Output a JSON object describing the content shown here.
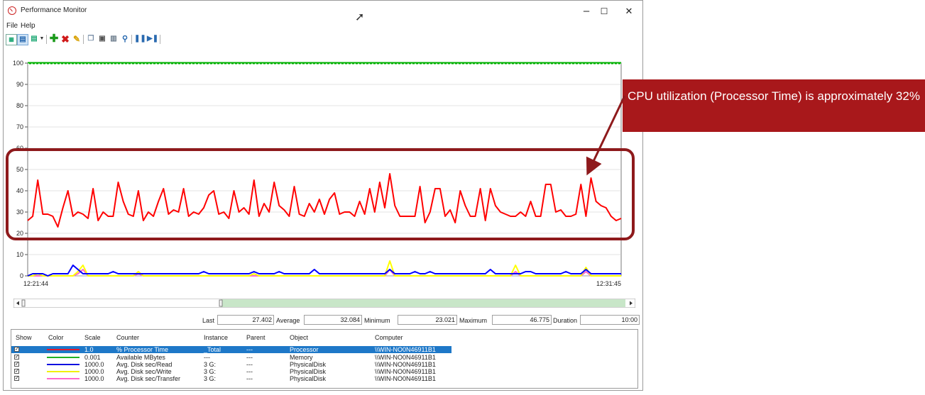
{
  "window": {
    "title": "Performance Monitor",
    "controls": {
      "minimize": "–",
      "maximize": "☐",
      "close": "✕"
    }
  },
  "menu": {
    "file": "File",
    "help": "Help"
  },
  "toolbar_icons": [
    "view-current-activity-icon",
    "view-log-data-icon",
    "change-graph-type-icon",
    "dropdown-arrow-icon",
    "add-counter-icon",
    "delete-counter-icon",
    "highlight-icon",
    "copy-properties-icon",
    "paste-counter-list-icon",
    "properties-icon",
    "zoom-icon",
    "freeze-display-icon",
    "update-data-icon"
  ],
  "chart": {
    "y_ticks": [
      "100",
      "90",
      "80",
      "70",
      "60",
      "50",
      "40",
      "30",
      "20",
      "10",
      "0"
    ],
    "ylim": [
      0,
      100
    ],
    "x_start_label": "12:21:44",
    "x_end_label": "12:31:45"
  },
  "chart_data": {
    "type": "line",
    "ylim": [
      0,
      100
    ],
    "x_labels": [
      "12:21:44",
      "12:31:45"
    ],
    "series": [
      {
        "name": "% Processor Time",
        "color": "#ff0000",
        "values": [
          26,
          28,
          45,
          29,
          29,
          28,
          23,
          32,
          40,
          28,
          30,
          29,
          27,
          41,
          26,
          30,
          28,
          28,
          44,
          35,
          29,
          28,
          40,
          26,
          30,
          28,
          35,
          41,
          29,
          31,
          30,
          41,
          28,
          30,
          29,
          32,
          38,
          40,
          29,
          30,
          27,
          40,
          30,
          32,
          29,
          45,
          28,
          34,
          30,
          44,
          33,
          31,
          28,
          42,
          29,
          28,
          34,
          30,
          36,
          29,
          36,
          39,
          29,
          30,
          30,
          28,
          35,
          29,
          41,
          30,
          44,
          32,
          48,
          33,
          28,
          28,
          28,
          28,
          42,
          25,
          30,
          41,
          41,
          28,
          31,
          25,
          40,
          33,
          28,
          28,
          41,
          26,
          41,
          33,
          30,
          29,
          28,
          28,
          30,
          28,
          35,
          28,
          28,
          43,
          43,
          30,
          31,
          28,
          28,
          29,
          43,
          28,
          46,
          35,
          33,
          32,
          28,
          26,
          27
        ]
      },
      {
        "name": "Available MBytes",
        "color": "#00b000",
        "values": [
          100,
          100,
          100,
          100,
          100,
          100,
          100,
          100,
          100,
          100,
          100,
          100,
          100,
          100,
          100,
          100,
          100,
          100,
          100,
          100,
          100,
          100,
          100,
          100,
          100,
          100,
          100,
          100,
          100,
          100,
          100,
          100,
          100,
          100,
          100,
          100,
          100,
          100,
          100,
          100,
          100,
          100,
          100,
          100,
          100,
          100,
          100,
          100,
          100,
          100,
          100,
          100,
          100,
          100,
          100,
          100,
          100,
          100,
          100,
          100,
          100,
          100,
          100,
          100,
          100,
          100,
          100,
          100,
          100,
          100,
          100,
          100,
          100,
          100,
          100,
          100,
          100,
          100,
          100,
          100,
          100,
          100,
          100,
          100,
          100,
          100,
          100,
          100,
          100,
          100,
          100,
          100,
          100,
          100,
          100,
          100,
          100,
          100,
          100,
          100,
          100,
          100,
          100,
          100,
          100,
          100,
          100,
          100,
          100,
          100,
          100,
          100,
          100,
          100,
          100,
          100,
          100,
          100,
          100
        ]
      },
      {
        "name": "Avg. Disk sec/Read",
        "color": "#0000ff",
        "values": [
          0,
          1,
          1,
          1,
          0,
          1,
          1,
          1,
          1,
          5,
          3,
          1,
          1,
          1,
          1,
          1,
          1,
          2,
          1,
          1,
          1,
          1,
          1,
          1,
          1,
          1,
          1,
          1,
          1,
          1,
          1,
          1,
          1,
          1,
          1,
          2,
          1,
          1,
          1,
          1,
          1,
          1,
          1,
          1,
          1,
          2,
          1,
          1,
          1,
          1,
          2,
          1,
          1,
          1,
          1,
          1,
          1,
          3,
          1,
          1,
          1,
          1,
          1,
          1,
          1,
          1,
          1,
          1,
          1,
          1,
          1,
          1,
          3,
          1,
          1,
          1,
          1,
          2,
          1,
          1,
          2,
          1,
          1,
          1,
          1,
          1,
          1,
          1,
          1,
          1,
          1,
          1,
          3,
          1,
          1,
          1,
          1,
          1,
          1,
          2,
          2,
          1,
          1,
          1,
          1,
          1,
          1,
          2,
          1,
          1,
          1,
          3,
          1,
          1,
          1,
          1,
          1,
          1,
          1
        ]
      },
      {
        "name": "Avg. Disk sec/Write",
        "color": "#ffff00",
        "values": [
          0,
          0,
          1,
          0,
          0,
          0,
          0,
          0,
          0,
          0,
          2,
          5,
          0,
          0,
          0,
          0,
          0,
          0,
          0,
          0,
          0,
          0,
          2,
          0,
          0,
          0,
          0,
          0,
          0,
          0,
          0,
          0,
          0,
          0,
          0,
          0,
          0,
          0,
          0,
          0,
          0,
          0,
          0,
          0,
          0,
          1,
          0,
          0,
          0,
          0,
          0,
          0,
          0,
          0,
          0,
          0,
          0,
          0,
          0,
          0,
          0,
          0,
          0,
          0,
          0,
          0,
          0,
          0,
          0,
          0,
          0,
          0,
          7,
          0,
          0,
          0,
          0,
          0,
          0,
          0,
          0,
          0,
          0,
          0,
          0,
          0,
          0,
          0,
          0,
          0,
          0,
          0,
          0,
          0,
          0,
          0,
          0,
          5,
          0,
          0,
          0,
          0,
          0,
          0,
          0,
          0,
          0,
          0,
          0,
          0,
          0,
          4,
          0,
          0,
          0,
          0,
          0,
          0,
          0
        ]
      },
      {
        "name": "Avg. Disk sec/Transfer",
        "color": "#ff66cc",
        "values": [
          0,
          0,
          0,
          0,
          0,
          0,
          0,
          0,
          0,
          0,
          1,
          3,
          0,
          0,
          0,
          0,
          0,
          0,
          0,
          0,
          0,
          0,
          1,
          0,
          0,
          0,
          0,
          0,
          0,
          0,
          0,
          0,
          0,
          0,
          0,
          0,
          0,
          0,
          0,
          0,
          0,
          0,
          0,
          0,
          0,
          0,
          0,
          0,
          0,
          0,
          0,
          0,
          0,
          0,
          0,
          0,
          0,
          0,
          0,
          0,
          0,
          0,
          0,
          0,
          0,
          0,
          0,
          0,
          0,
          0,
          0,
          0,
          3,
          0,
          0,
          0,
          0,
          0,
          0,
          0,
          0,
          0,
          0,
          0,
          0,
          0,
          0,
          0,
          0,
          0,
          0,
          0,
          0,
          0,
          0,
          0,
          0,
          2,
          0,
          0,
          0,
          0,
          0,
          0,
          0,
          0,
          0,
          0,
          0,
          0,
          0,
          2,
          0,
          0,
          0,
          0,
          0,
          0,
          0
        ]
      }
    ]
  },
  "stats": {
    "last_label": "Last",
    "last": "27.402",
    "average_label": "Average",
    "average": "32.084",
    "minimum_label": "Minimum",
    "minimum": "23.021",
    "maximum_label": "Maximum",
    "maximum": "46.775",
    "duration_label": "Duration",
    "duration": "10:00"
  },
  "legend": {
    "headers": {
      "show": "Show",
      "color": "Color",
      "scale": "Scale",
      "counter": "Counter",
      "instance": "Instance",
      "parent": "Parent",
      "object": "Object",
      "computer": "Computer"
    },
    "rows": [
      {
        "color": "#e8192c",
        "scale": "1.0",
        "counter": "% Processor Time",
        "instance": "_Total",
        "parent": "---",
        "object": "Processor",
        "computer": "\\\\WIN-NO0N46911B1"
      },
      {
        "color": "#22b322",
        "scale": "0.001",
        "counter": "Available MBytes",
        "instance": "---",
        "parent": "---",
        "object": "Memory",
        "computer": "\\\\WIN-NO0N46911B1"
      },
      {
        "color": "#1010e0",
        "scale": "1000.0",
        "counter": "Avg. Disk sec/Read",
        "instance": "3 G:",
        "parent": "---",
        "object": "PhysicalDisk",
        "computer": "\\\\WIN-NO0N46911B1"
      },
      {
        "color": "#f0f000",
        "scale": "1000.0",
        "counter": "Avg. Disk sec/Write",
        "instance": "3 G:",
        "parent": "---",
        "object": "PhysicalDisk",
        "computer": "\\\\WIN-NO0N46911B1"
      },
      {
        "color": "#ff66cc",
        "scale": "1000.0",
        "counter": "Avg. Disk sec/Transfer",
        "instance": "3 G:",
        "parent": "---",
        "object": "PhysicalDisk",
        "computer": "\\\\WIN-NO0N46911B1"
      }
    ]
  },
  "callout": {
    "text": "CPU utilization (Processor Time) is approximately 32%"
  }
}
